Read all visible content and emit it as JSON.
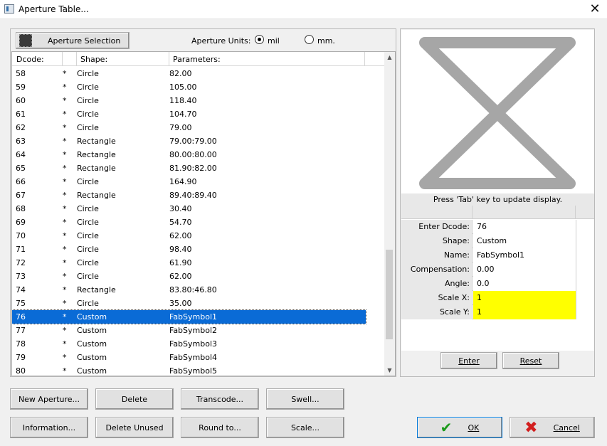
{
  "window": {
    "title": "Aperture Table..."
  },
  "toolbar": {
    "aperture_selection_label": "Aperture Selection",
    "units_label": "Aperture Units:",
    "unit_options": [
      "mil",
      "mm."
    ],
    "selected_unit": "mil"
  },
  "table": {
    "headers": [
      "Dcode:",
      "Shape:",
      "Parameters:"
    ],
    "rows": [
      {
        "dcode": "58",
        "mark": "*",
        "shape": "Circle",
        "params": "82.00"
      },
      {
        "dcode": "59",
        "mark": "*",
        "shape": "Circle",
        "params": "105.00"
      },
      {
        "dcode": "60",
        "mark": "*",
        "shape": "Circle",
        "params": "118.40"
      },
      {
        "dcode": "61",
        "mark": "*",
        "shape": "Circle",
        "params": "104.70"
      },
      {
        "dcode": "62",
        "mark": "*",
        "shape": "Circle",
        "params": "79.00"
      },
      {
        "dcode": "63",
        "mark": "*",
        "shape": "Rectangle",
        "params": "79.00:79.00"
      },
      {
        "dcode": "64",
        "mark": "*",
        "shape": "Rectangle",
        "params": "80.00:80.00"
      },
      {
        "dcode": "65",
        "mark": "*",
        "shape": "Rectangle",
        "params": "81.90:82.00"
      },
      {
        "dcode": "66",
        "mark": "*",
        "shape": "Circle",
        "params": "164.90"
      },
      {
        "dcode": "67",
        "mark": "*",
        "shape": "Rectangle",
        "params": "89.40:89.40"
      },
      {
        "dcode": "68",
        "mark": "*",
        "shape": "Circle",
        "params": "30.40"
      },
      {
        "dcode": "69",
        "mark": "*",
        "shape": "Circle",
        "params": "54.70"
      },
      {
        "dcode": "70",
        "mark": "*",
        "shape": "Circle",
        "params": "62.00"
      },
      {
        "dcode": "71",
        "mark": "*",
        "shape": "Circle",
        "params": "98.40"
      },
      {
        "dcode": "72",
        "mark": "*",
        "shape": "Circle",
        "params": "61.90"
      },
      {
        "dcode": "73",
        "mark": "*",
        "shape": "Circle",
        "params": "62.00"
      },
      {
        "dcode": "74",
        "mark": "*",
        "shape": "Rectangle",
        "params": "83.80:46.80"
      },
      {
        "dcode": "75",
        "mark": "*",
        "shape": "Circle",
        "params": "35.00"
      },
      {
        "dcode": "76",
        "mark": "*",
        "shape": "Custom",
        "params": "FabSymbol1",
        "selected": true
      },
      {
        "dcode": "77",
        "mark": "*",
        "shape": "Custom",
        "params": "FabSymbol2"
      },
      {
        "dcode": "78",
        "mark": "*",
        "shape": "Custom",
        "params": "FabSymbol3"
      },
      {
        "dcode": "79",
        "mark": "*",
        "shape": "Custom",
        "params": "FabSymbol4"
      },
      {
        "dcode": "80",
        "mark": "*",
        "shape": "Custom",
        "params": "FabSymbol5"
      }
    ]
  },
  "preview": {
    "hint": "Press 'Tab' key  to update display."
  },
  "properties": [
    {
      "label": "Enter Dcode:",
      "value": "76",
      "highlight": false
    },
    {
      "label": "Shape:",
      "value": "Custom",
      "highlight": false
    },
    {
      "label": "Name:",
      "value": "FabSymbol1",
      "highlight": false
    },
    {
      "label": "Compensation:",
      "value": "0.00",
      "highlight": false
    },
    {
      "label": "Angle:",
      "value": "0.0",
      "highlight": false
    },
    {
      "label": "Scale X:",
      "value": "1",
      "highlight": true
    },
    {
      "label": "Scale Y:",
      "value": "1",
      "highlight": true
    }
  ],
  "panel_buttons": {
    "enter": "Enter",
    "reset": "Reset"
  },
  "buttons": {
    "new_aperture": "New Aperture...",
    "delete": "Delete",
    "transcode": "Transcode...",
    "swell": "Swell...",
    "information": "Information...",
    "delete_unused": "Delete Unused",
    "round_to": "Round to...",
    "scale": "Scale...",
    "ok": "OK",
    "cancel": "Cancel"
  },
  "colors": {
    "selection": "#0a6bd6",
    "highlight": "#ffff00",
    "preview_shape": "#a6a6a6"
  }
}
